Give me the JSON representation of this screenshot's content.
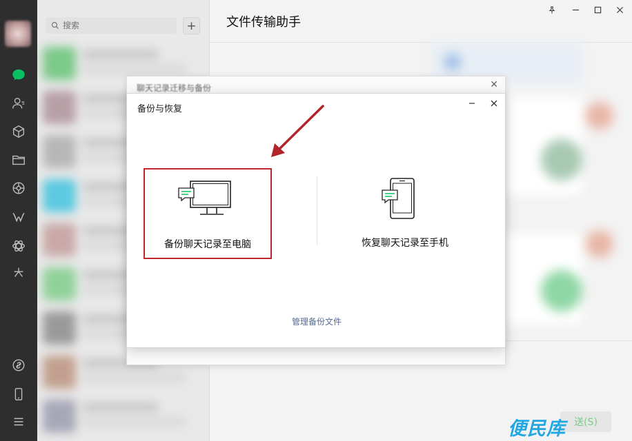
{
  "search": {
    "placeholder": "搜索"
  },
  "chat": {
    "title": "文件传输助手",
    "send_label": "送(S)"
  },
  "back_dialog": {
    "title": "聊天记录迁移与备份"
  },
  "dialog": {
    "title": "备份与恢复",
    "option_backup": "备份聊天记录至电脑",
    "option_restore": "恢复聊天记录至手机",
    "manage_link": "管理备份文件"
  },
  "watermark": "便民库",
  "icons": {
    "nav": [
      "chat-icon",
      "contacts-icon",
      "favorites-icon",
      "files-icon",
      "moments-icon",
      "channels-icon",
      "mini-programs-icon",
      "search-discover-icon",
      "link-icon",
      "phone-icon",
      "menu-icon"
    ],
    "window": [
      "pin-icon",
      "minimize-icon",
      "maximize-icon",
      "close-icon"
    ]
  },
  "colors": {
    "accent": "#07c160",
    "highlight": "#c0262b",
    "link": "#576b95",
    "watermark": "#23a7e0"
  }
}
